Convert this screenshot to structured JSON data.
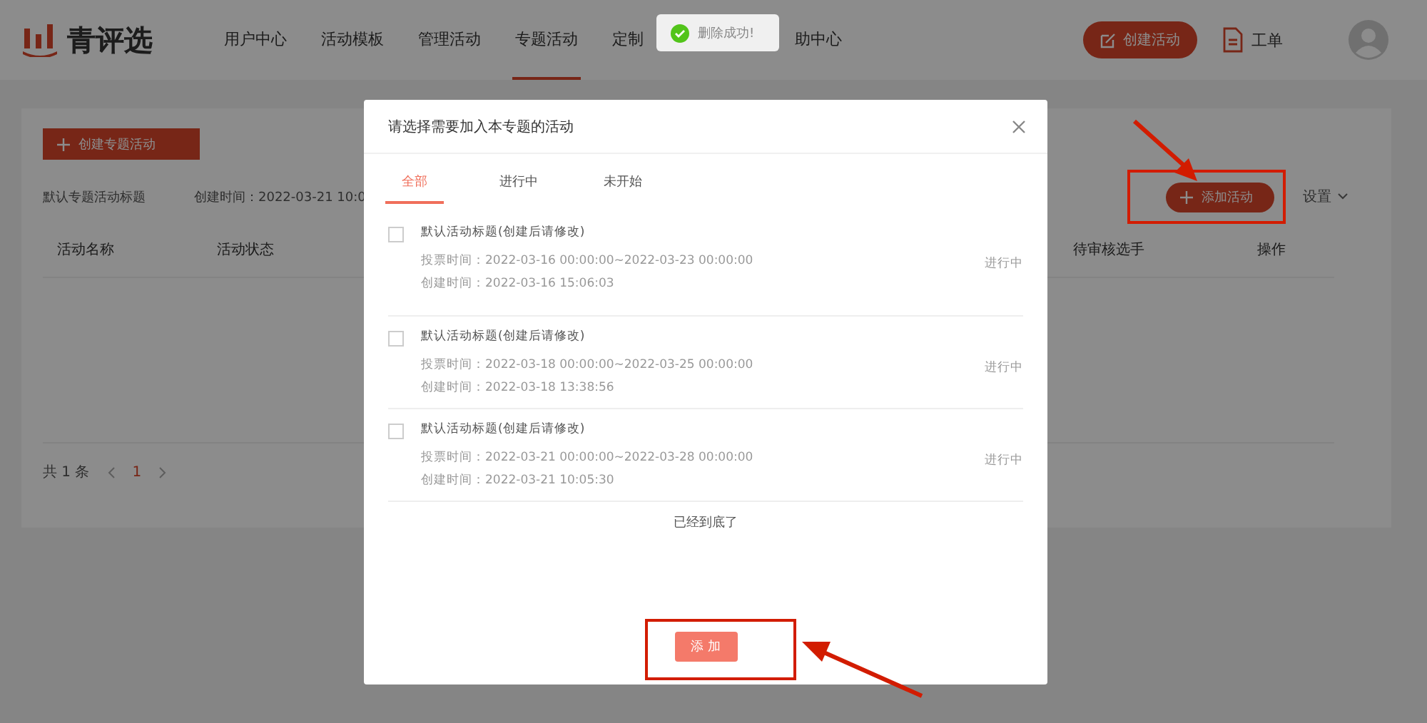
{
  "header": {
    "logo": "青评选",
    "nav": [
      {
        "label": "用户中心",
        "selected": false
      },
      {
        "label": "活动模板",
        "selected": false
      },
      {
        "label": "管理活动",
        "selected": false
      },
      {
        "label": "专题活动",
        "selected": true
      },
      {
        "label": "定制",
        "selected": false
      },
      {
        "label": "助中心",
        "selected": false
      }
    ],
    "create_button": "创建活动",
    "ticket": "工单"
  },
  "toast": {
    "text": "删除成功!"
  },
  "page": {
    "create_topic_button": "创建专题活动",
    "topic_title": "默认专题活动标题",
    "created": "创建时间：2022-03-21 10:0",
    "add_button": "添加活动",
    "settings": "设置",
    "columns": [
      {
        "label": "活动名称",
        "kind": "left"
      },
      {
        "label": "活动状态",
        "kind": "left"
      },
      {
        "label": "待审核选手",
        "kind": "right"
      },
      {
        "label": "操作",
        "kind": "right"
      }
    ],
    "total": "共 1 条",
    "page_number": "1"
  },
  "modal": {
    "title": "请选择需要加入本专题的活动",
    "tabs": [
      {
        "label": "全部",
        "selected": true
      },
      {
        "label": "进行中",
        "selected": false
      },
      {
        "label": "未开始",
        "selected": false
      }
    ],
    "items": [
      {
        "checked": false,
        "title": "默认活动标题(创建后请修改)",
        "vote_time": "投票时间：2022-03-16 00:00:00~2022-03-23 00:00:00",
        "created": "创建时间：2022-03-16 15:06:03",
        "status": "进行中"
      },
      {
        "checked": false,
        "title": "默认活动标题(创建后请修改)",
        "vote_time": "投票时间：2022-03-18 00:00:00~2022-03-25 00:00:00",
        "created": "创建时间：2022-03-18 13:38:56",
        "status": "进行中"
      },
      {
        "checked": false,
        "title": "默认活动标题(创建后请修改)",
        "vote_time": "投票时间：2022-03-21 00:00:00~2022-03-28 00:00:00",
        "created": "创建时间：2022-03-21 10:05:30",
        "status": "进行中"
      }
    ],
    "end_note": "已经到底了",
    "add_button": "添 加"
  }
}
